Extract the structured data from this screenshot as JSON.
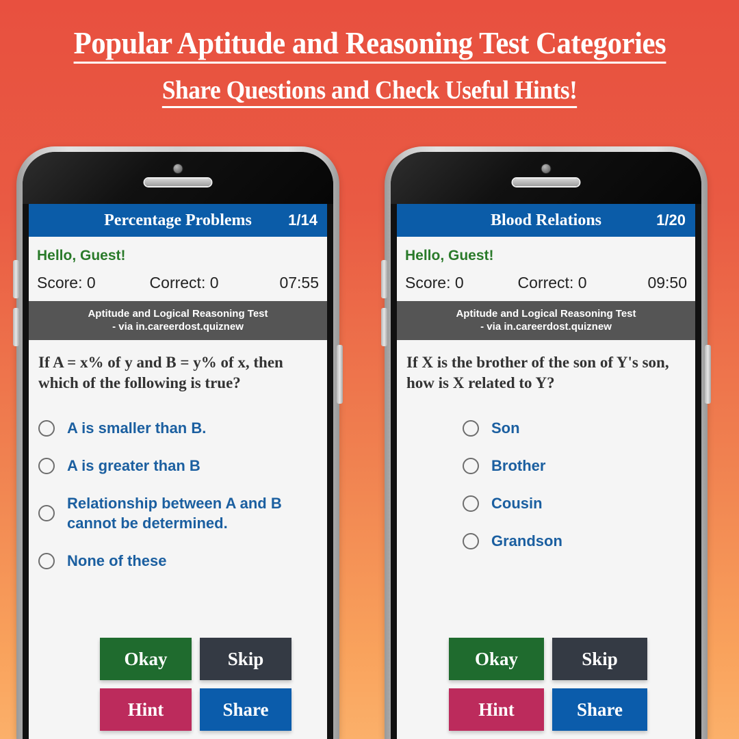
{
  "headline": {
    "line1": "Popular Aptitude and Reasoning Test Categories",
    "line2": "Share Questions and Check Useful Hints!"
  },
  "colors": {
    "bg_top": "#e8503f",
    "bg_bottom": "#f9a25c",
    "appbar_blue": "#0b5ca8",
    "greeting_green": "#2a7a2a",
    "ad_gray": "#555555",
    "option_blue": "#1b5fa0",
    "okay_green": "#1f6b2e",
    "skip_slate": "#343a44",
    "hint_crimson": "#bc2b5c",
    "share_blue": "#0b5cab"
  },
  "ad": {
    "line1": "Aptitude and Logical Reasoning Test",
    "line2": "- via in.careerdost.quiznew"
  },
  "buttons": {
    "okay": "Okay",
    "skip": "Skip",
    "hint": "Hint",
    "share": "Share"
  },
  "phones": [
    {
      "title": "Percentage Problems",
      "count": "1/14",
      "greeting": "Hello, Guest!",
      "score": "Score: 0",
      "correct": "Correct: 0",
      "timer": "07:55",
      "question": "If A = x% of y and B = y% of x, then which of the following is true?",
      "options": [
        "A is smaller than B.",
        "A is greater than B",
        "Relationship between A and B cannot be determined.",
        "None of these"
      ]
    },
    {
      "title": "Blood Relations",
      "count": "1/20",
      "greeting": "Hello, Guest!",
      "score": "Score: 0",
      "correct": "Correct: 0",
      "timer": "09:50",
      "question": "If X is the brother of the son of Y's son, how is X related to Y?",
      "options": [
        "Son",
        "Brother",
        "Cousin",
        "Grandson"
      ]
    }
  ]
}
